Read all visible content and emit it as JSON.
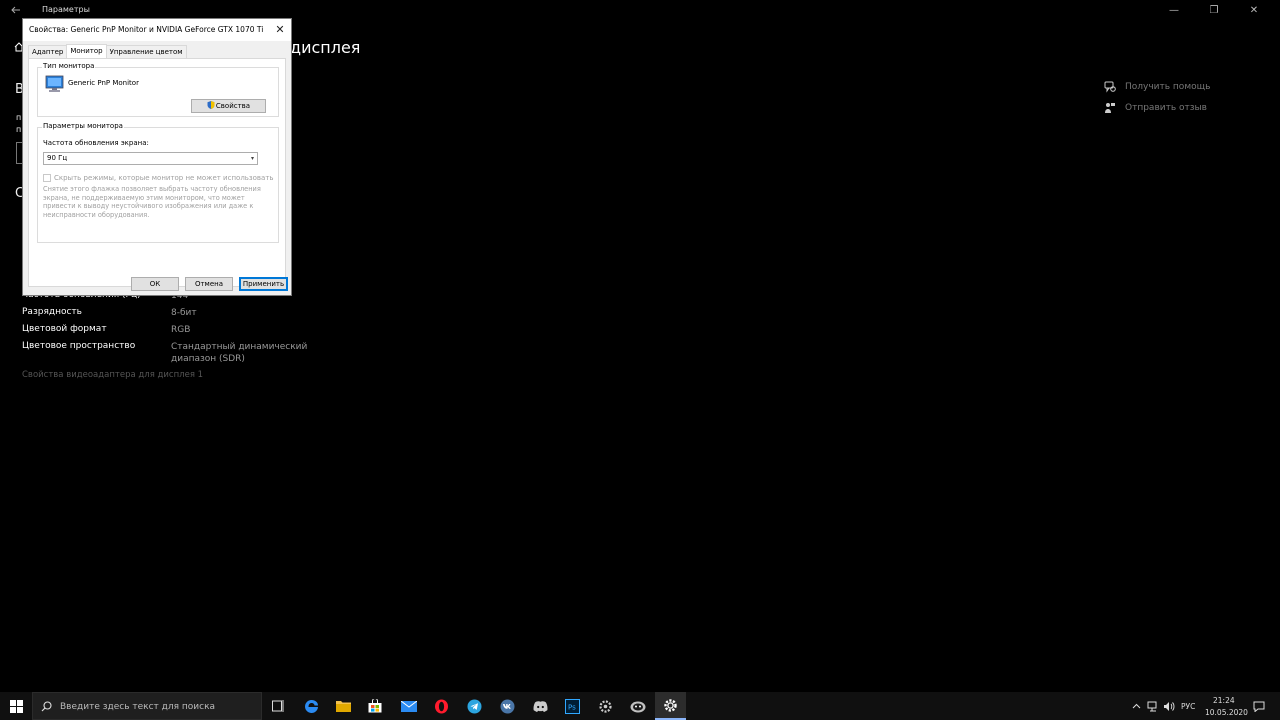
{
  "window": {
    "title": "Параметры",
    "controls": {
      "minimize": "—",
      "maximize": "❐",
      "close": "✕"
    }
  },
  "page": {
    "heading": "дисплея",
    "peek_letters": [
      "В",
      "п",
      "п",
      "С"
    ],
    "side_links": [
      {
        "icon": "chat-help-icon",
        "label": "Получить помощь"
      },
      {
        "icon": "feedback-icon",
        "label": "Отправить отзыв"
      }
    ],
    "properties": [
      {
        "key": "Частота обновления (Гц)",
        "value": "144"
      },
      {
        "key": "Разрядность",
        "value": "8-бит"
      },
      {
        "key": "Цветовой формат",
        "value": "RGB"
      },
      {
        "key": "Цветовое пространство",
        "value": "Стандартный динамический диапазон (SDR)"
      }
    ],
    "adapter_link": "Свойства видеоадаптера для дисплея 1"
  },
  "dialog": {
    "title": "Свойства: Generic PnP Monitor и NVIDIA GeForce GTX 1070 Ti",
    "close": "✕",
    "tabs": [
      {
        "label": "Адаптер",
        "active": false
      },
      {
        "label": "Монитор",
        "active": true
      },
      {
        "label": "Управление цветом",
        "active": false
      }
    ],
    "monitor_type": {
      "group_title": "Тип монитора",
      "monitor_name": "Generic PnP Monitor",
      "properties_button": "Свойства"
    },
    "monitor_settings": {
      "group_title": "Параметры монитора",
      "refresh_label": "Частота обновления экрана:",
      "refresh_value": "90 Гц",
      "hide_modes_label": "Скрыть режимы, которые монитор не может использовать",
      "hide_modes_checked": false,
      "description": "Снятие этого флажка позволяет выбрать частоту обновления экрана, не поддерживаемую этим монитором, что может привести к выводу неустойчивого изображения или даже к неисправности оборудования."
    },
    "buttons": {
      "ok": "ОК",
      "cancel": "Отмена",
      "apply": "Применить"
    }
  },
  "taskbar": {
    "search_placeholder": "Введите здесь текст для поиска",
    "pinned": [
      "task-view-icon",
      "edge-icon",
      "file-explorer-icon",
      "store-icon",
      "mail-icon",
      "opera-icon",
      "telegram-icon",
      "vk-icon",
      "discord-icon",
      "photoshop-icon",
      "gear-tool-icon",
      "game-icon",
      "settings-icon"
    ],
    "language": "РУС",
    "time": "21:24",
    "date": "10.05.2020"
  },
  "colors": {
    "accent": "#0078d7",
    "background": "#000000",
    "dialog": "#f0f0f0"
  }
}
